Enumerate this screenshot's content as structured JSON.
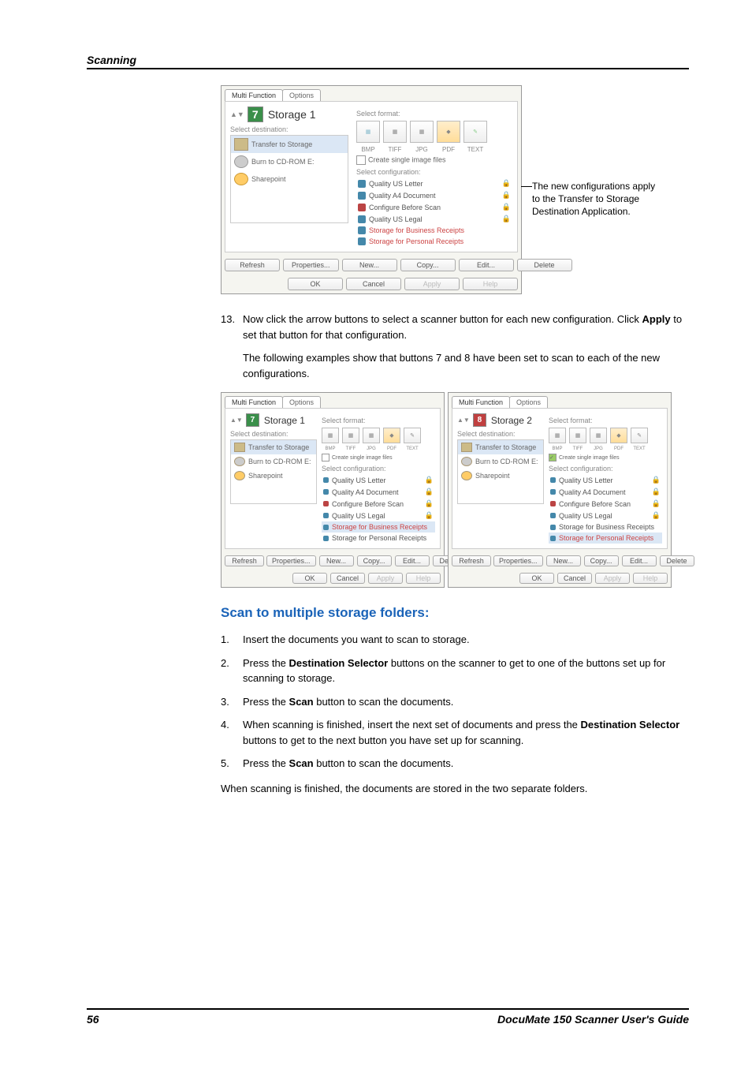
{
  "header": {
    "section": "Scanning"
  },
  "fig1": {
    "tabs": {
      "t1": "Multi Function",
      "t2": "Options"
    },
    "panel_title": "Storage 1",
    "panel_num": "7",
    "sel_dest_label": "Select destination:",
    "dests": {
      "d1": "Transfer to Storage",
      "d2": "Burn to CD-ROM  E:",
      "d3": "Sharepoint"
    },
    "fmt_label": "Select format:",
    "fmt_names": {
      "bmp": "BMP",
      "tiff": "TIFF",
      "jpg": "JPG",
      "pdf": "PDF",
      "text": "TEXT"
    },
    "chk1": "Create single image files",
    "cfg_label": "Select configuration:",
    "cfgs": {
      "c1": "Quality US Letter",
      "c2": "Quality A4 Document",
      "c3": "Configure Before Scan",
      "c4": "Quality US Legal",
      "c5": "Storage for Business Receipts",
      "c6": "Storage for Personal Receipts"
    },
    "btns": {
      "refresh": "Refresh",
      "props": "Properties...",
      "new": "New...",
      "copy": "Copy...",
      "edit": "Edit...",
      "del": "Delete",
      "ok": "OK",
      "cancel": "Cancel",
      "apply": "Apply",
      "help": "Help"
    }
  },
  "annot1": "The new configurations apply to the Transfer to Storage Destination Application.",
  "step13_num": "13.",
  "step13_a": "Now click the arrow buttons to select a scanner button for each new configuration. Click ",
  "step13_bold": "Apply",
  "step13_b": " to set that button for that configuration.",
  "step13_follow": "The following examples show that buttons 7 and 8 have been set to scan to each of the new configurations.",
  "fig2a": {
    "title": "Storage 1",
    "num": "7",
    "sel_cfg": "Storage for Business Receipts"
  },
  "fig2b": {
    "title": "Storage 2",
    "num": "8",
    "sel_cfg": "Storage for Personal Receipts"
  },
  "h2": "Scan to multiple storage folders:",
  "s1_n": "1.",
  "s1": "Insert the documents you want to scan to storage.",
  "s2_n": "2.",
  "s2_a": "Press the ",
  "s2_b": "Destination Selector",
  "s2_c": " buttons on the scanner to get to one of the buttons set up for scanning to storage.",
  "s3_n": "3.",
  "s3_a": "Press the ",
  "s3_b": "Scan",
  "s3_c": " button to scan the documents.",
  "s4_n": "4.",
  "s4_a": "When scanning is finished, insert the next set of documents and press the ",
  "s4_b": "Destination Selector",
  "s4_c": " buttons to get to the next button you have set up for scanning.",
  "s5_n": "5.",
  "s5_a": "Press the ",
  "s5_b": "Scan",
  "s5_c": " button to scan the documents.",
  "closing": "When scanning is finished, the documents are stored in the two separate folders.",
  "footer": {
    "page": "56",
    "title": "DocuMate 150 Scanner User's Guide"
  }
}
